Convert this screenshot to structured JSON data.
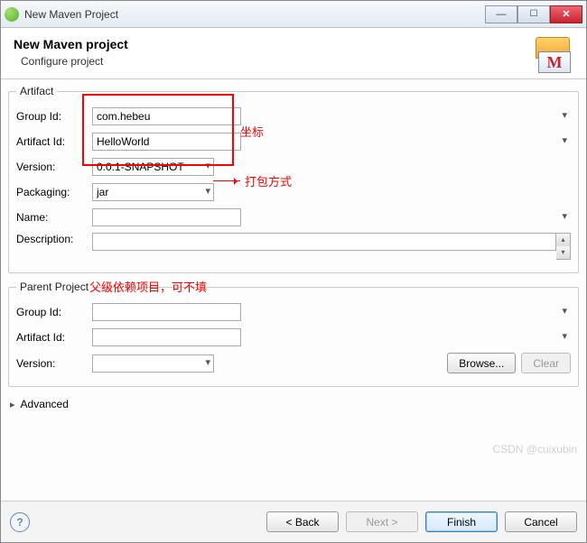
{
  "window": {
    "title": "New Maven Project"
  },
  "header": {
    "title": "New Maven project",
    "subtitle": "Configure project",
    "icon_letter": "M"
  },
  "artifact": {
    "legend": "Artifact",
    "labels": {
      "group_id": "Group Id:",
      "artifact_id": "Artifact Id:",
      "version": "Version:",
      "packaging": "Packaging:",
      "name": "Name:",
      "description": "Description:"
    },
    "values": {
      "group_id": "com.hebeu",
      "artifact_id": "HelloWorld",
      "version": "0.0.1-SNAPSHOT",
      "packaging": "jar",
      "name": "",
      "description": ""
    }
  },
  "parent": {
    "legend": "Parent Project",
    "labels": {
      "group_id": "Group Id:",
      "artifact_id": "Artifact Id:",
      "version": "Version:",
      "browse": "Browse...",
      "clear": "Clear"
    },
    "values": {
      "group_id": "",
      "artifact_id": "",
      "version": ""
    }
  },
  "advanced_label": "Advanced",
  "footer": {
    "back": "< Back",
    "next": "Next >",
    "finish": "Finish",
    "cancel": "Cancel"
  },
  "annotations": {
    "coords": "坐标",
    "packaging": "打包方式",
    "parent": "父级依赖项目，可不填"
  },
  "watermark": "CSDN @cuixubin"
}
